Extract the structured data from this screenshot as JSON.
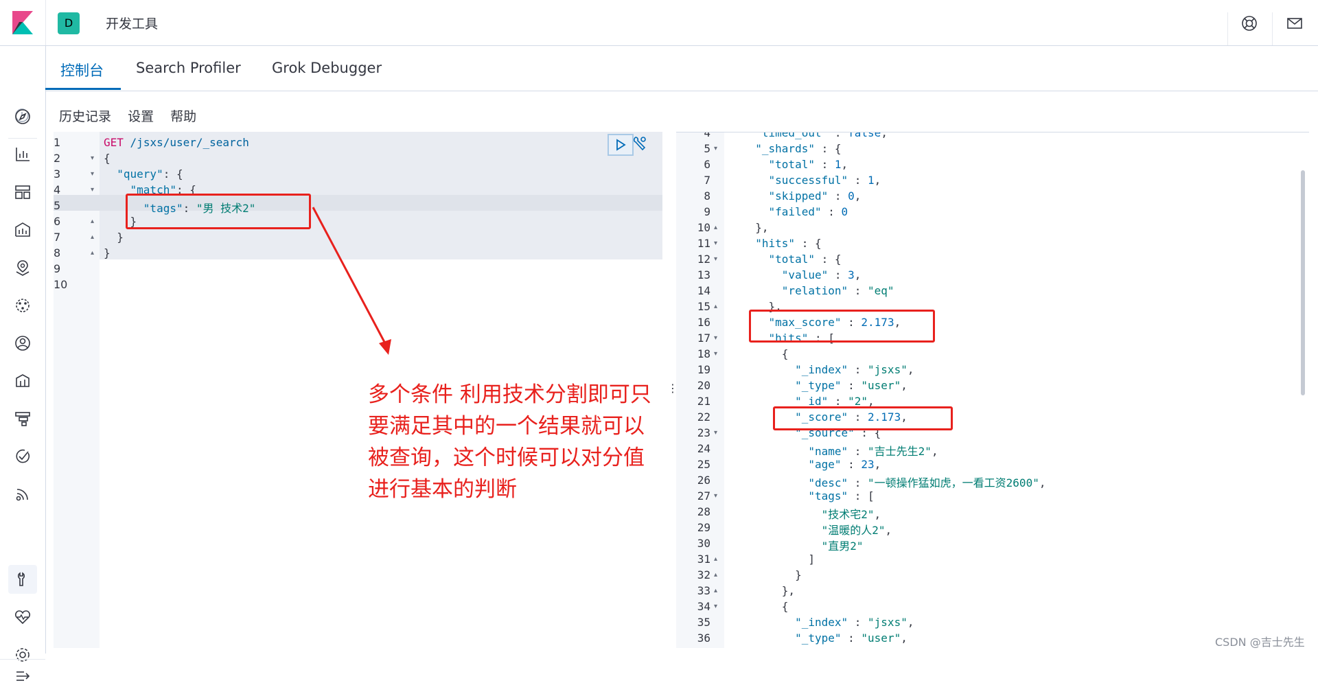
{
  "header": {
    "space_initial": "D",
    "app_title": "开发工具"
  },
  "tabs": [
    "控制台",
    "Search Profiler",
    "Grok Debugger"
  ],
  "subnav": [
    "历史记录",
    "设置",
    "帮助"
  ],
  "sidebar_icons": [
    "clock-icon",
    "compass-icon",
    "visualize-icon",
    "dashboard-icon",
    "canvas-icon",
    "maps-icon",
    "ml-icon",
    "infrastructure-icon",
    "logs-icon",
    "apm-icon",
    "uptime-icon",
    "siem-icon",
    "devtools-icon",
    "monitoring-icon",
    "management-icon",
    "collapse-icon"
  ],
  "request": {
    "lines": [
      {
        "n": "1",
        "fold": ""
      },
      {
        "n": "2",
        "fold": "▾"
      },
      {
        "n": "3",
        "fold": "▾"
      },
      {
        "n": "4",
        "fold": "▾"
      },
      {
        "n": "5",
        "fold": ""
      },
      {
        "n": "6",
        "fold": "▴"
      },
      {
        "n": "7",
        "fold": "▴"
      },
      {
        "n": "8",
        "fold": "▴"
      },
      {
        "n": "9",
        "fold": ""
      },
      {
        "n": "10",
        "fold": ""
      }
    ],
    "method": "GET",
    "url": "/jsxs/user/_search",
    "key_query": "\"query\"",
    "key_match": "\"match\"",
    "key_tags": "\"tags\"",
    "val_tags": "\"男 技术2\""
  },
  "response": {
    "lines": [
      {
        "n": "4",
        "fold": "",
        "text": "  \"timed_out\" : false,"
      },
      {
        "n": "5",
        "fold": "▾",
        "text": "  \"_shards\" : {"
      },
      {
        "n": "6",
        "fold": "",
        "text": "    \"total\" : 1,"
      },
      {
        "n": "7",
        "fold": "",
        "text": "    \"successful\" : 1,"
      },
      {
        "n": "8",
        "fold": "",
        "text": "    \"skipped\" : 0,"
      },
      {
        "n": "9",
        "fold": "",
        "text": "    \"failed\" : 0"
      },
      {
        "n": "10",
        "fold": "▴",
        "text": "  },"
      },
      {
        "n": "11",
        "fold": "▾",
        "text": "  \"hits\" : {"
      },
      {
        "n": "12",
        "fold": "▾",
        "text": "    \"total\" : {"
      },
      {
        "n": "13",
        "fold": "",
        "text": "      \"value\" : 3,"
      },
      {
        "n": "14",
        "fold": "",
        "text": "      \"relation\" : \"eq\""
      },
      {
        "n": "15",
        "fold": "▴",
        "text": "    },"
      },
      {
        "n": "16",
        "fold": "",
        "text": "    \"max_score\" : 2.173,"
      },
      {
        "n": "17",
        "fold": "▾",
        "text": "    \"hits\" : ["
      },
      {
        "n": "18",
        "fold": "▾",
        "text": "      {"
      },
      {
        "n": "19",
        "fold": "",
        "text": "        \"_index\" : \"jsxs\","
      },
      {
        "n": "20",
        "fold": "",
        "text": "        \"_type\" : \"user\","
      },
      {
        "n": "21",
        "fold": "",
        "text": "        \"_id\" : \"2\","
      },
      {
        "n": "22",
        "fold": "",
        "text": "        \"_score\" : 2.173,"
      },
      {
        "n": "23",
        "fold": "▾",
        "text": "        \"_source\" : {"
      },
      {
        "n": "24",
        "fold": "",
        "text": "          \"name\" : \"吉士先生2\","
      },
      {
        "n": "25",
        "fold": "",
        "text": "          \"age\" : 23,"
      },
      {
        "n": "26",
        "fold": "",
        "text": "          \"desc\" : \"一顿操作猛如虎，一看工资2600\","
      },
      {
        "n": "27",
        "fold": "▾",
        "text": "          \"tags\" : ["
      },
      {
        "n": "28",
        "fold": "",
        "text": "            \"技术宅2\","
      },
      {
        "n": "29",
        "fold": "",
        "text": "            \"温暖的人2\","
      },
      {
        "n": "30",
        "fold": "",
        "text": "            \"直男2\""
      },
      {
        "n": "31",
        "fold": "▴",
        "text": "          ]"
      },
      {
        "n": "32",
        "fold": "▴",
        "text": "        }"
      },
      {
        "n": "33",
        "fold": "▴",
        "text": "      },"
      },
      {
        "n": "34",
        "fold": "▾",
        "text": "      {"
      },
      {
        "n": "35",
        "fold": "",
        "text": "        \"_index\" : \"jsxs\","
      },
      {
        "n": "36",
        "fold": "",
        "text": "        \"_type\" : \"user\","
      }
    ]
  },
  "annotation": "多个条件 利用技术分割即可只要满足其中的一个结果就可以被查询，这个时候可以对分值进行基本的判断",
  "watermark": "CSDN @吉士先生",
  "colors": {
    "accent": "#006bb8",
    "annotation": "#e8211d",
    "badge": "#20b9a3"
  }
}
